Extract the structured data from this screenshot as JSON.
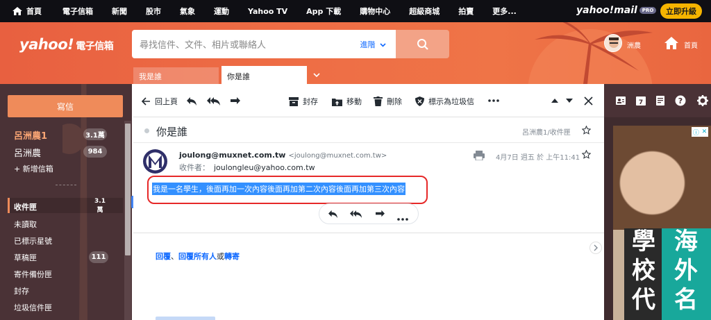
{
  "topnav": {
    "items": [
      "首頁",
      "電子信箱",
      "新聞",
      "股市",
      "氣象",
      "運動",
      "Yahoo TV",
      "App 下載",
      "購物中心",
      "超級商城",
      "拍賣",
      "更多..."
    ],
    "mail_logo": "yahoo!mail",
    "pro_badge": "PRO",
    "upgrade_label": "立即升級"
  },
  "header": {
    "brand": "yahoo!",
    "brand_sub": "電子信箱",
    "search_placeholder": "尋找信件、文件、相片或聯絡人",
    "advanced_label": "進階",
    "user_name": "洲農",
    "home_label": "首頁"
  },
  "tabs": [
    {
      "label": "我是誰"
    },
    {
      "label": "你是誰"
    }
  ],
  "sidebar": {
    "compose_label": "寫信",
    "accounts": [
      {
        "label": "呂洲農1",
        "count": "3.1萬"
      },
      {
        "label": "呂洲農",
        "count": "984"
      }
    ],
    "add_mailbox": "+ 新增信箱",
    "folders": [
      {
        "label": "收件匣",
        "count": "3.1萬"
      },
      {
        "label": "未讀取",
        "count": ""
      },
      {
        "label": "已標示星號",
        "count": ""
      },
      {
        "label": "草稿匣",
        "count": "111"
      },
      {
        "label": "寄件備份匣",
        "count": ""
      },
      {
        "label": "封存",
        "count": ""
      },
      {
        "label": "垃圾信件匣",
        "count": ""
      }
    ]
  },
  "toolbar": {
    "back": "回上頁",
    "archive": "封存",
    "move": "移動",
    "delete": "刪除",
    "spam": "標示為垃圾信"
  },
  "message": {
    "subject": "你是誰",
    "folder_path": "呂洲農1/收件匣",
    "from_email": "joulong@muxnet.com.tw",
    "from_addr": "<joulong@muxnet.com.tw>",
    "to_label": "收件者：",
    "to_addr": "joulongleu@yahoo.com.tw",
    "date": "4月7日 週五 於 上午11:41",
    "body": "我是一名學生，後面再加一次內容後面再加第二次內容後面再加第三次內容"
  },
  "reply_links": {
    "reply": "回覆",
    "sep1": "、",
    "reply_all": "回覆所有人",
    "or": "或",
    "forward": "轉寄"
  },
  "ad": {
    "text_left": "學校代",
    "text_right": "海外名"
  },
  "colors": {
    "header_orange": "#ee6d45",
    "sidebar_bg": "#4a3236",
    "accent_orange": "#ef8b5a",
    "link_blue": "#0f69ff",
    "selection_blue": "#3390ff",
    "annotation_red": "#e62828"
  }
}
